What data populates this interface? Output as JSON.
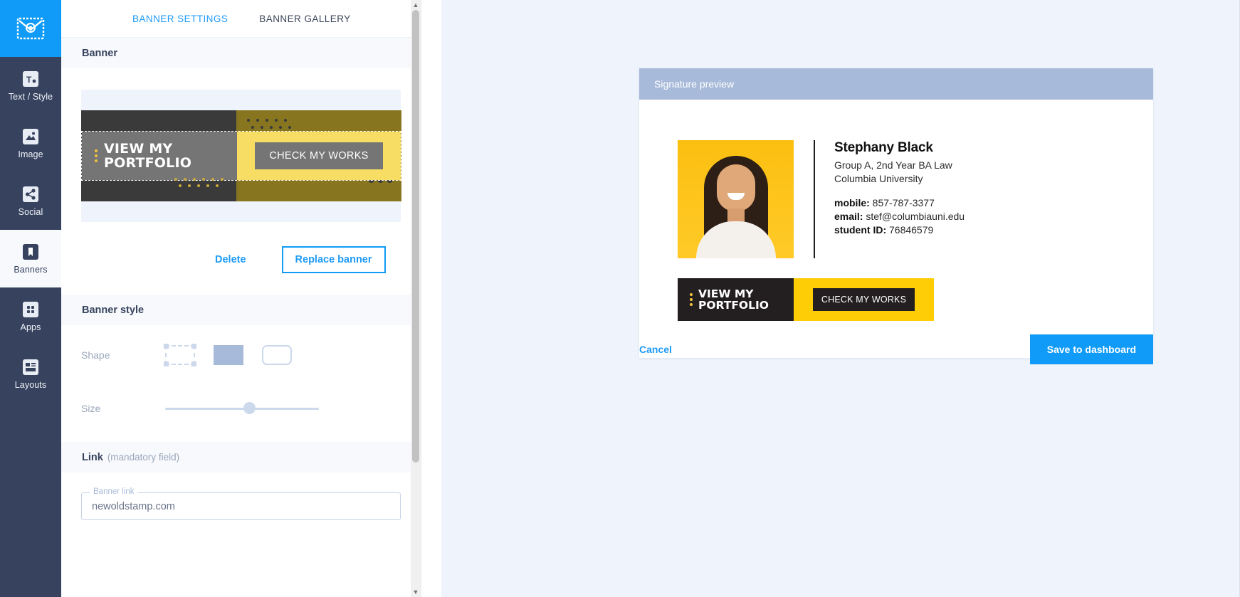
{
  "rail": {
    "logo_icon": "envelope-at-logo-icon",
    "items": [
      {
        "label": "Text / Style",
        "icon": "text-style-icon",
        "active": false
      },
      {
        "label": "Image",
        "icon": "image-icon",
        "active": false
      },
      {
        "label": "Social",
        "icon": "share-icon",
        "active": false
      },
      {
        "label": "Banners",
        "icon": "bookmark-icon",
        "active": true
      },
      {
        "label": "Apps",
        "icon": "apps-grid-icon",
        "active": false
      },
      {
        "label": "Layouts",
        "icon": "layouts-icon",
        "active": false
      }
    ]
  },
  "panel": {
    "tabs": [
      {
        "label": "BANNER SETTINGS",
        "active": true
      },
      {
        "label": "BANNER GALLERY",
        "active": false
      }
    ],
    "banner_section": {
      "title": "Banner",
      "banner_left_text": "VIEW MY PORTFOLIO",
      "banner_button_text": "CHECK MY WORKS",
      "delete_label": "Delete",
      "replace_label": "Replace banner"
    },
    "style_section": {
      "title": "Banner style",
      "shape_label": "Shape",
      "shape_options": [
        "dashed-rectangle",
        "solid-rectangle",
        "rounded-rectangle"
      ],
      "shape_selected": "solid-rectangle",
      "size_label": "Size",
      "size_value": 50
    },
    "link_section": {
      "title": "Link",
      "title_note": "(mandatory field)",
      "field_label": "Banner link",
      "field_value": "newoldstamp.com",
      "field_placeholder": "Banner link"
    }
  },
  "preview": {
    "header": "Signature preview",
    "signature": {
      "name": "Stephany Black",
      "role_line1": "Group A, 2nd Year BA Law",
      "role_line2": "Columbia University",
      "mobile_key": "mobile:",
      "mobile_value": "857-787-3377",
      "email_key": "email:",
      "email_value": "stef@columbiauni.edu",
      "student_key": "student ID:",
      "student_value": "76846579",
      "banner_left_text": "VIEW MY PORTFOLIO",
      "banner_button_text": "CHECK MY WORKS"
    },
    "cancel_label": "Cancel",
    "save_label": "Save to dashboard"
  },
  "colors": {
    "accent": "#0f9bf7",
    "rail_bg": "#37435e",
    "preview_bg": "#eef3fc",
    "preview_header": "#a8bada",
    "banner_yellow": "#ffcd05",
    "banner_dark": "#231f20"
  }
}
